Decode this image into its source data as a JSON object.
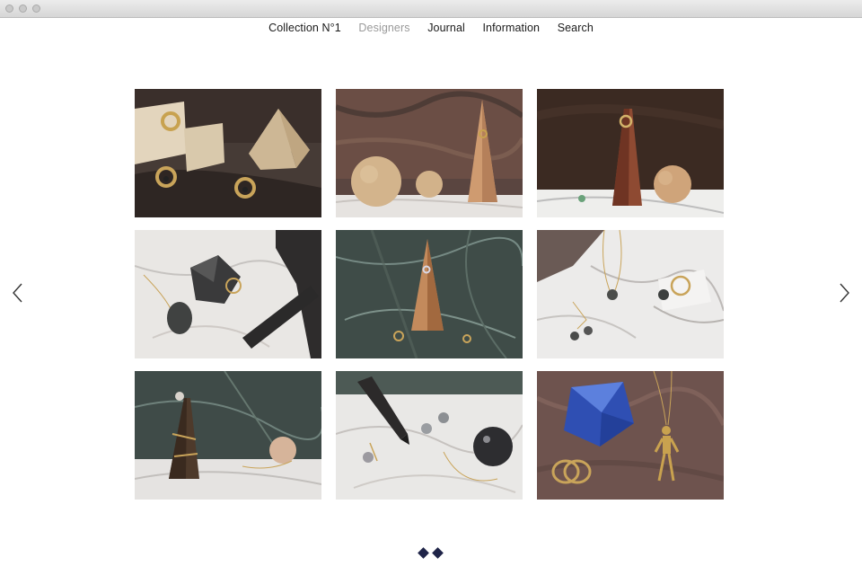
{
  "window": {
    "controls": [
      "close",
      "minimize",
      "zoom"
    ]
  },
  "nav": {
    "items": [
      {
        "label": "Collection N°1",
        "active": false
      },
      {
        "label": "Designers",
        "active": true
      },
      {
        "label": "Journal",
        "active": false
      },
      {
        "label": "Information",
        "active": false
      },
      {
        "label": "Search",
        "active": false
      }
    ]
  },
  "gallery": {
    "tiles": [
      {
        "subject": "gold signet rings with wooden cube and pyramid on dark wood"
      },
      {
        "subject": "wooden spheres and cone ring holder on red granite"
      },
      {
        "subject": "stone obelisk and wooden sphere on white marble"
      },
      {
        "subject": "pendant necklace and dark crystal on white marble"
      },
      {
        "subject": "wooden cone ring holder on green marble"
      },
      {
        "subject": "pearl necklaces and earrings on white marble"
      },
      {
        "subject": "brown obelisk and round box on green marble"
      },
      {
        "subject": "black crystal and pearl studs on white marble"
      },
      {
        "subject": "blue crystal and gold figure pendant on pink granite"
      }
    ],
    "prev_icon": "chevron-left-icon",
    "next_icon": "chevron-right-icon"
  },
  "pagination": {
    "pages": 2,
    "colors": {
      "dot": "#1f2448"
    }
  }
}
